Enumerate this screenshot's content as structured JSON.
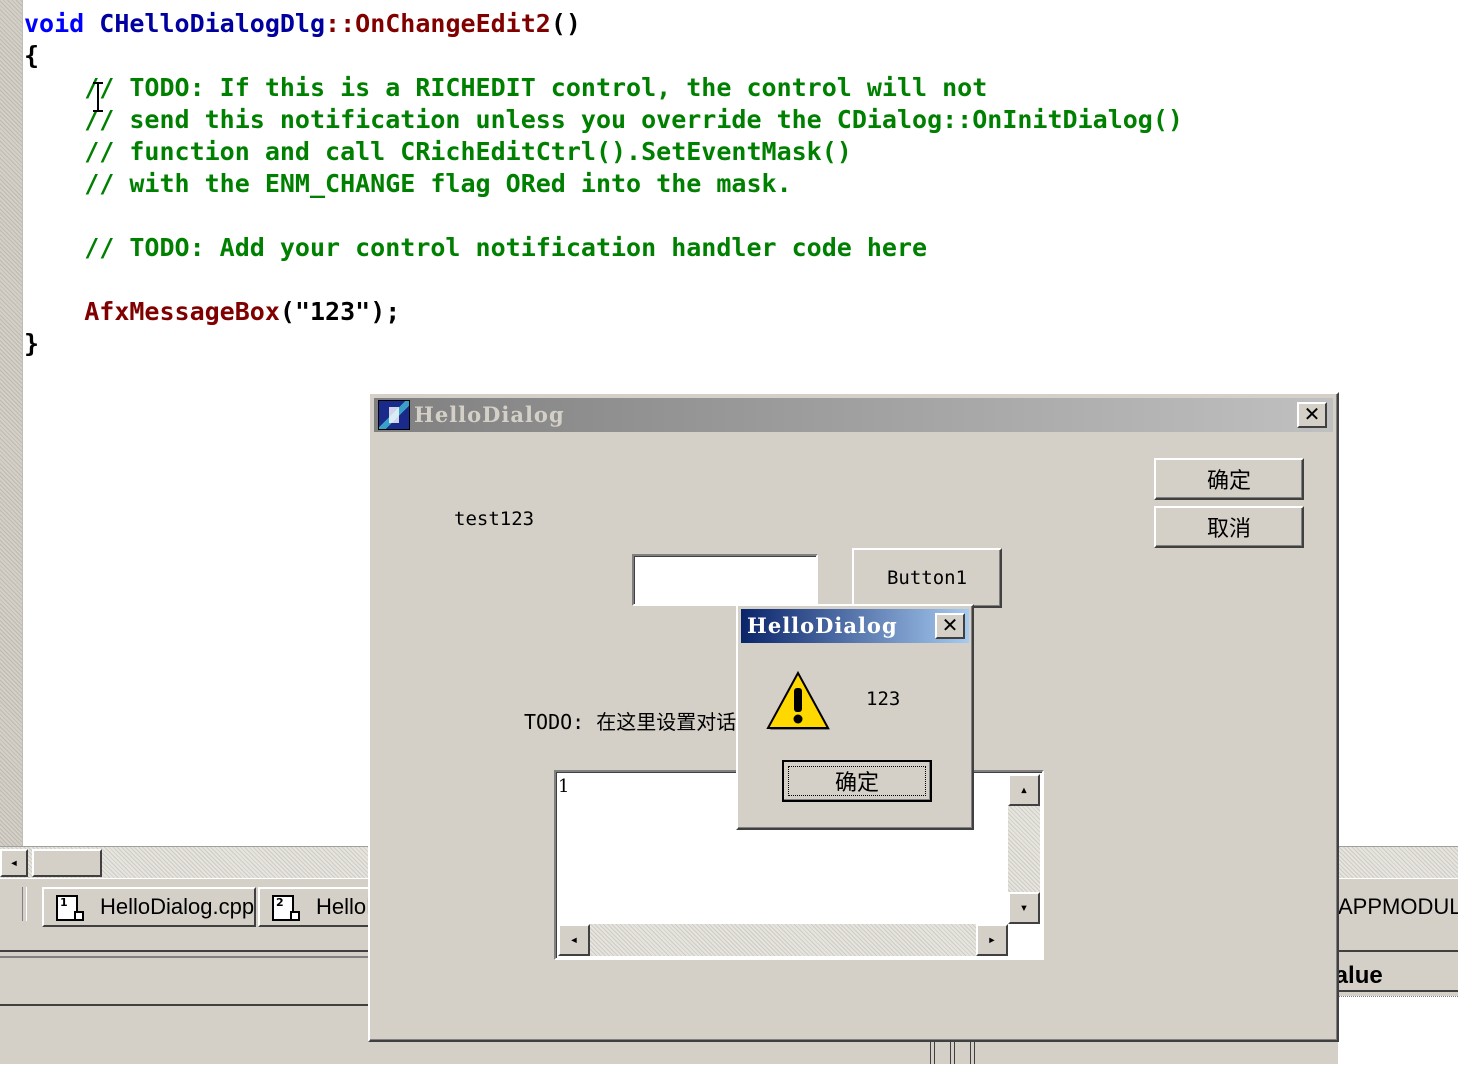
{
  "editor": {
    "lines": [
      {
        "parts": [
          {
            "t": "void ",
            "c": "kw"
          },
          {
            "t": "CHelloDialogDlg",
            "c": "cls"
          },
          {
            "t": "::",
            "c": "fn"
          },
          {
            "t": "OnChangeEdit2",
            "c": "fn"
          },
          {
            "t": "()",
            "c": ""
          }
        ]
      },
      {
        "parts": [
          {
            "t": "{",
            "c": ""
          }
        ]
      },
      {
        "parts": [
          {
            "t": "    // TODO: If this is a RICHEDIT control, the control will not",
            "c": "cm"
          }
        ]
      },
      {
        "parts": [
          {
            "t": "    // send this notification unless you override the CDialog::OnInitDialog()",
            "c": "cm"
          }
        ]
      },
      {
        "parts": [
          {
            "t": "    // function and call CRichEditCtrl().SetEventMask()",
            "c": "cm"
          }
        ]
      },
      {
        "parts": [
          {
            "t": "    // with the ENM_CHANGE flag ORed into the mask.",
            "c": "cm"
          }
        ]
      },
      {
        "parts": [
          {
            "t": "",
            "c": ""
          }
        ]
      },
      {
        "parts": [
          {
            "t": "    // TODO: Add your control notification handler code here",
            "c": "cm"
          }
        ]
      },
      {
        "parts": [
          {
            "t": "",
            "c": ""
          }
        ]
      },
      {
        "parts": [
          {
            "t": "    ",
            "c": ""
          },
          {
            "t": "AfxMessageBox",
            "c": "fn"
          },
          {
            "t": "(\"123\");",
            "c": ""
          }
        ]
      },
      {
        "parts": [
          {
            "t": "}",
            "c": ""
          }
        ]
      }
    ]
  },
  "scroll": {
    "left_arrow": "◂",
    "right_arrow": "▸",
    "up_arrow": "▴",
    "down_arrow": "▾"
  },
  "tabs": [
    {
      "label": "HelloDialog.cpp",
      "icon_digit": "1"
    },
    {
      "label": "HelloDialog.h",
      "icon_digit": "2"
    }
  ],
  "app_module_text": "APPMODUL",
  "value_header": "Value",
  "dialog": {
    "title": "HelloDialog",
    "close": "✕",
    "ok_label": "确定",
    "cancel_label": "取消",
    "static_label": "test123",
    "edit_value": "",
    "button1_label": "Button1",
    "todo_label": "TODO: 在这里设置对话控制。",
    "list_value": "1"
  },
  "msgbox": {
    "title": "HelloDialog",
    "close": "✕",
    "icon": "warning-icon",
    "message": "123",
    "ok_label": "确定"
  },
  "colors": {
    "keyword": "#0000ff",
    "comment": "#008000",
    "function": "#800000",
    "active_title": "#0a246a",
    "inactive_title": "#808080",
    "face": "#d4d0c8"
  }
}
